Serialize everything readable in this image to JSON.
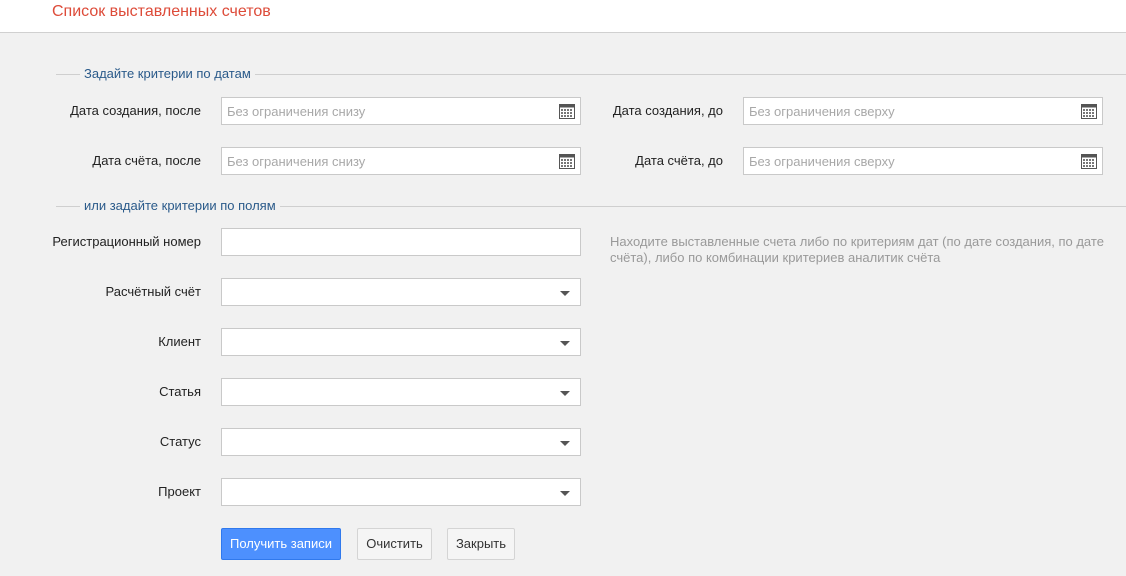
{
  "header": {
    "title": "Список выставленных счетов"
  },
  "date_section": {
    "legend": "Задайте критерии по датам",
    "created_after": {
      "label": "Дата создания, после",
      "placeholder": "Без ограничения снизу",
      "value": ""
    },
    "created_before": {
      "label": "Дата создания, до",
      "placeholder": "Без ограничения сверху",
      "value": ""
    },
    "invoice_after": {
      "label": "Дата счёта, после",
      "placeholder": "Без ограничения снизу",
      "value": ""
    },
    "invoice_before": {
      "label": "Дата счёта, до",
      "placeholder": "Без ограничения сверху",
      "value": ""
    }
  },
  "fields_section": {
    "legend": "или задайте критерии по полям",
    "reg_number": {
      "label": "Регистрационный номер",
      "value": ""
    },
    "account": {
      "label": "Расчётный счёт",
      "value": ""
    },
    "client": {
      "label": "Клиент",
      "value": ""
    },
    "article": {
      "label": "Статья",
      "value": ""
    },
    "status": {
      "label": "Статус",
      "value": ""
    },
    "project": {
      "label": "Проект",
      "value": ""
    },
    "hint": "Находите выставленные счета либо по критериям дат (по дате создания, по дате счёта), либо по комбинации критериев аналитик счёта"
  },
  "buttons": {
    "get_records": "Получить записи",
    "clear": "Очистить",
    "close": "Закрыть"
  },
  "icons": {
    "calendar": "calendar-icon",
    "dropdown": "chevron-down-icon"
  },
  "colors": {
    "title": "#dd4b39",
    "legend": "#2a5a8a",
    "primary_button": "#4d90fe"
  }
}
